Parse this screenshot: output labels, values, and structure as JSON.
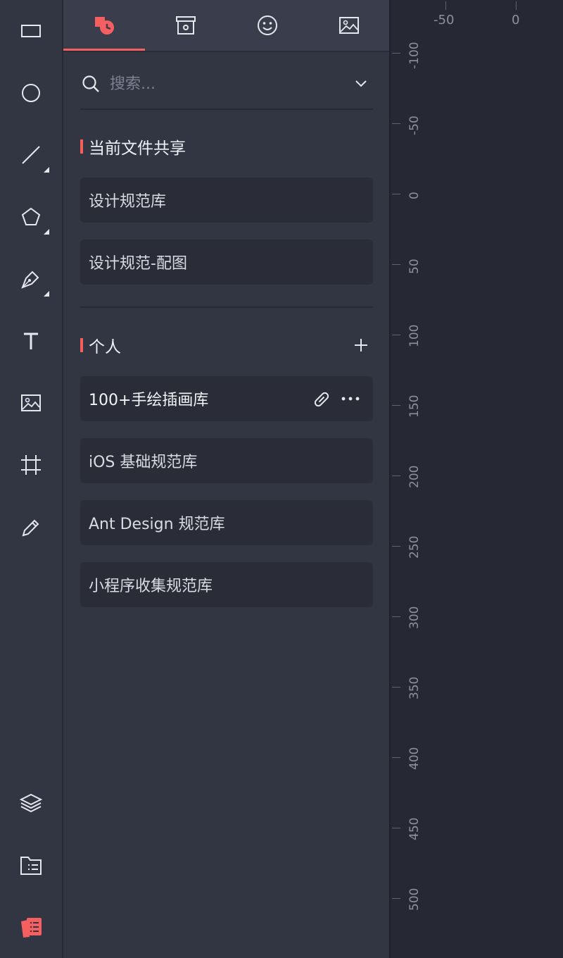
{
  "toolbar": {
    "tools": [
      "rectangle-icon",
      "ellipse-icon",
      "line-icon",
      "polygon-icon",
      "pen-icon",
      "text-icon",
      "image-icon",
      "artboard-icon",
      "pencil-icon"
    ],
    "bottom_tools": [
      "layers-icon",
      "files-icon",
      "component-library-icon"
    ],
    "accent": "#f55f5f"
  },
  "tabs": {
    "items": [
      "components-icon",
      "archive-icon",
      "emoji-icon",
      "image-icon"
    ],
    "active": 0
  },
  "search": {
    "placeholder": "搜索..."
  },
  "shared_section": {
    "title": "当前文件共享",
    "items": [
      "设计规范库",
      "设计规范-配图"
    ]
  },
  "personal_section": {
    "title": "个人",
    "items": [
      "100+手绘插画库",
      "iOS 基础规范库",
      "Ant Design 规范库",
      "小程序收集规范库"
    ]
  },
  "ruler": {
    "horizontal_labels": [
      "-50",
      "0"
    ],
    "vertical_labels": [
      "-100",
      "-50",
      "0",
      "50",
      "100",
      "150",
      "200",
      "250",
      "300",
      "350",
      "400",
      "450",
      "500"
    ]
  }
}
